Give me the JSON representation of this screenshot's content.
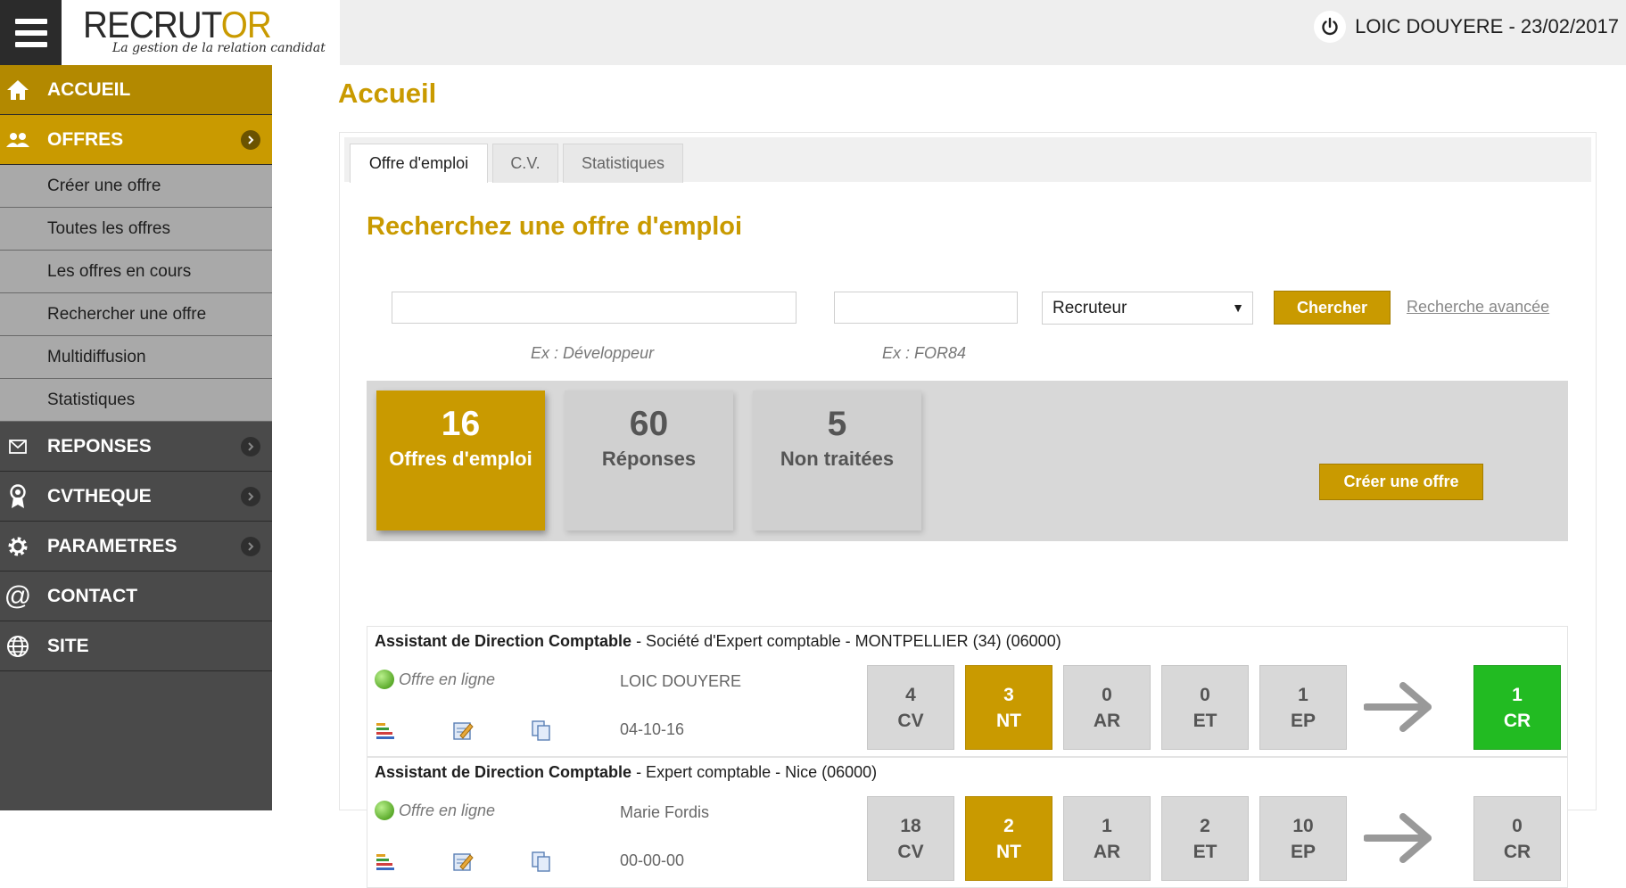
{
  "header": {
    "brand_main": "RECRUT",
    "brand_accent": "OR",
    "tagline": "La gestion de la relation candidat",
    "user_label": "LOIC DOUYERE - 23/02/2017"
  },
  "sidebar": {
    "items": [
      {
        "label": "ACCUEIL",
        "icon": "home-icon"
      },
      {
        "label": "OFFRES",
        "icon": "users-icon"
      },
      {
        "label": "REPONSES",
        "icon": "envelope-icon"
      },
      {
        "label": "CVTHEQUE",
        "icon": "award-icon"
      },
      {
        "label": "PARAMETRES",
        "icon": "gear-icon"
      },
      {
        "label": "CONTACT",
        "icon": "at-icon"
      },
      {
        "label": "SITE",
        "icon": "globe-icon"
      }
    ],
    "subitems": [
      "Créer une offre",
      "Toutes les offres",
      "Les offres en cours",
      "Rechercher une offre",
      "Multidiffusion",
      "Statistiques"
    ]
  },
  "main": {
    "page_title": "Accueil",
    "tabs": [
      {
        "label": "Offre d'emploi",
        "active": true
      },
      {
        "label": "C.V.",
        "active": false
      },
      {
        "label": "Statistiques",
        "active": false
      }
    ],
    "search": {
      "title": "Recherchez une offre d'emploi",
      "keyword_value": "",
      "ref_value": "",
      "keyword_hint": "Ex : Développeur",
      "ref_hint": "Ex : FOR84",
      "recruteur_selected": "Recruteur",
      "search_button": "Chercher",
      "advanced_link": "Recherche avancée"
    },
    "stats": [
      {
        "value": "16",
        "label": "Offres d'emploi",
        "active": true
      },
      {
        "value": "60",
        "label": "Réponses",
        "active": false
      },
      {
        "value": "5",
        "label": "Non traitées",
        "active": false
      }
    ],
    "create_button": "Créer une offre",
    "offers": [
      {
        "title": "Assistant de Direction Comptable",
        "details": " - Société d'Expert comptable - MONTPELLIER (34) (06000)",
        "status": "Offre en ligne",
        "recruiter": "LOIC DOUYERE",
        "date": "04-10-16",
        "counts": [
          {
            "value": "4",
            "label": "CV"
          },
          {
            "value": "3",
            "label": "NT"
          },
          {
            "value": "0",
            "label": "AR"
          },
          {
            "value": "0",
            "label": "ET"
          },
          {
            "value": "1",
            "label": "EP"
          },
          {
            "value": "1",
            "label": "CR"
          }
        ]
      },
      {
        "title": "Assistant de Direction Comptable",
        "details": " - Expert comptable - Nice (06000)",
        "status": "Offre en ligne",
        "recruiter": "Marie Fordis",
        "date": "00-00-00",
        "counts": [
          {
            "value": "18",
            "label": "CV"
          },
          {
            "value": "2",
            "label": "NT"
          },
          {
            "value": "1",
            "label": "AR"
          },
          {
            "value": "2",
            "label": "ET"
          },
          {
            "value": "10",
            "label": "EP"
          },
          {
            "value": "0",
            "label": "CR"
          }
        ]
      }
    ]
  },
  "colors": {
    "gold": "#c99a00",
    "dark_gold": "#b38900",
    "sidebar_bg": "#4a4a4a",
    "subitem_bg": "#a9a9a9",
    "green": "#22bb22"
  }
}
